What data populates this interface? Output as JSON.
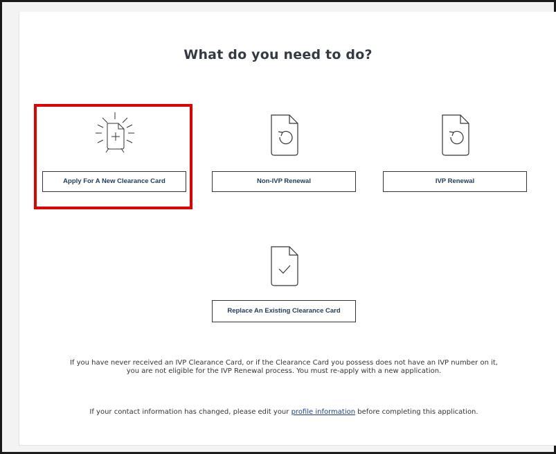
{
  "heading": "What do you need to do?",
  "options": [
    {
      "label": "Apply For A New Clearance Card",
      "icon": "new-document-icon"
    },
    {
      "label": "Non-IVP Renewal",
      "icon": "renew-document-icon"
    },
    {
      "label": "IVP Renewal",
      "icon": "renew-document-icon"
    },
    {
      "label": "Replace An Existing Clearance Card",
      "icon": "check-document-icon"
    }
  ],
  "highlight_color": "#e00000",
  "notes": {
    "eligibility": "If you have never received an IVP Clearance Card, or if the Clearance Card you possess does not have an IVP number on it, you are not eligible for the IVP Renewal process. You must re-apply with a new application.",
    "contact_prefix": "If your contact information has changed, please edit your",
    "contact_link": "profile information",
    "contact_suffix": "before completing this application."
  }
}
